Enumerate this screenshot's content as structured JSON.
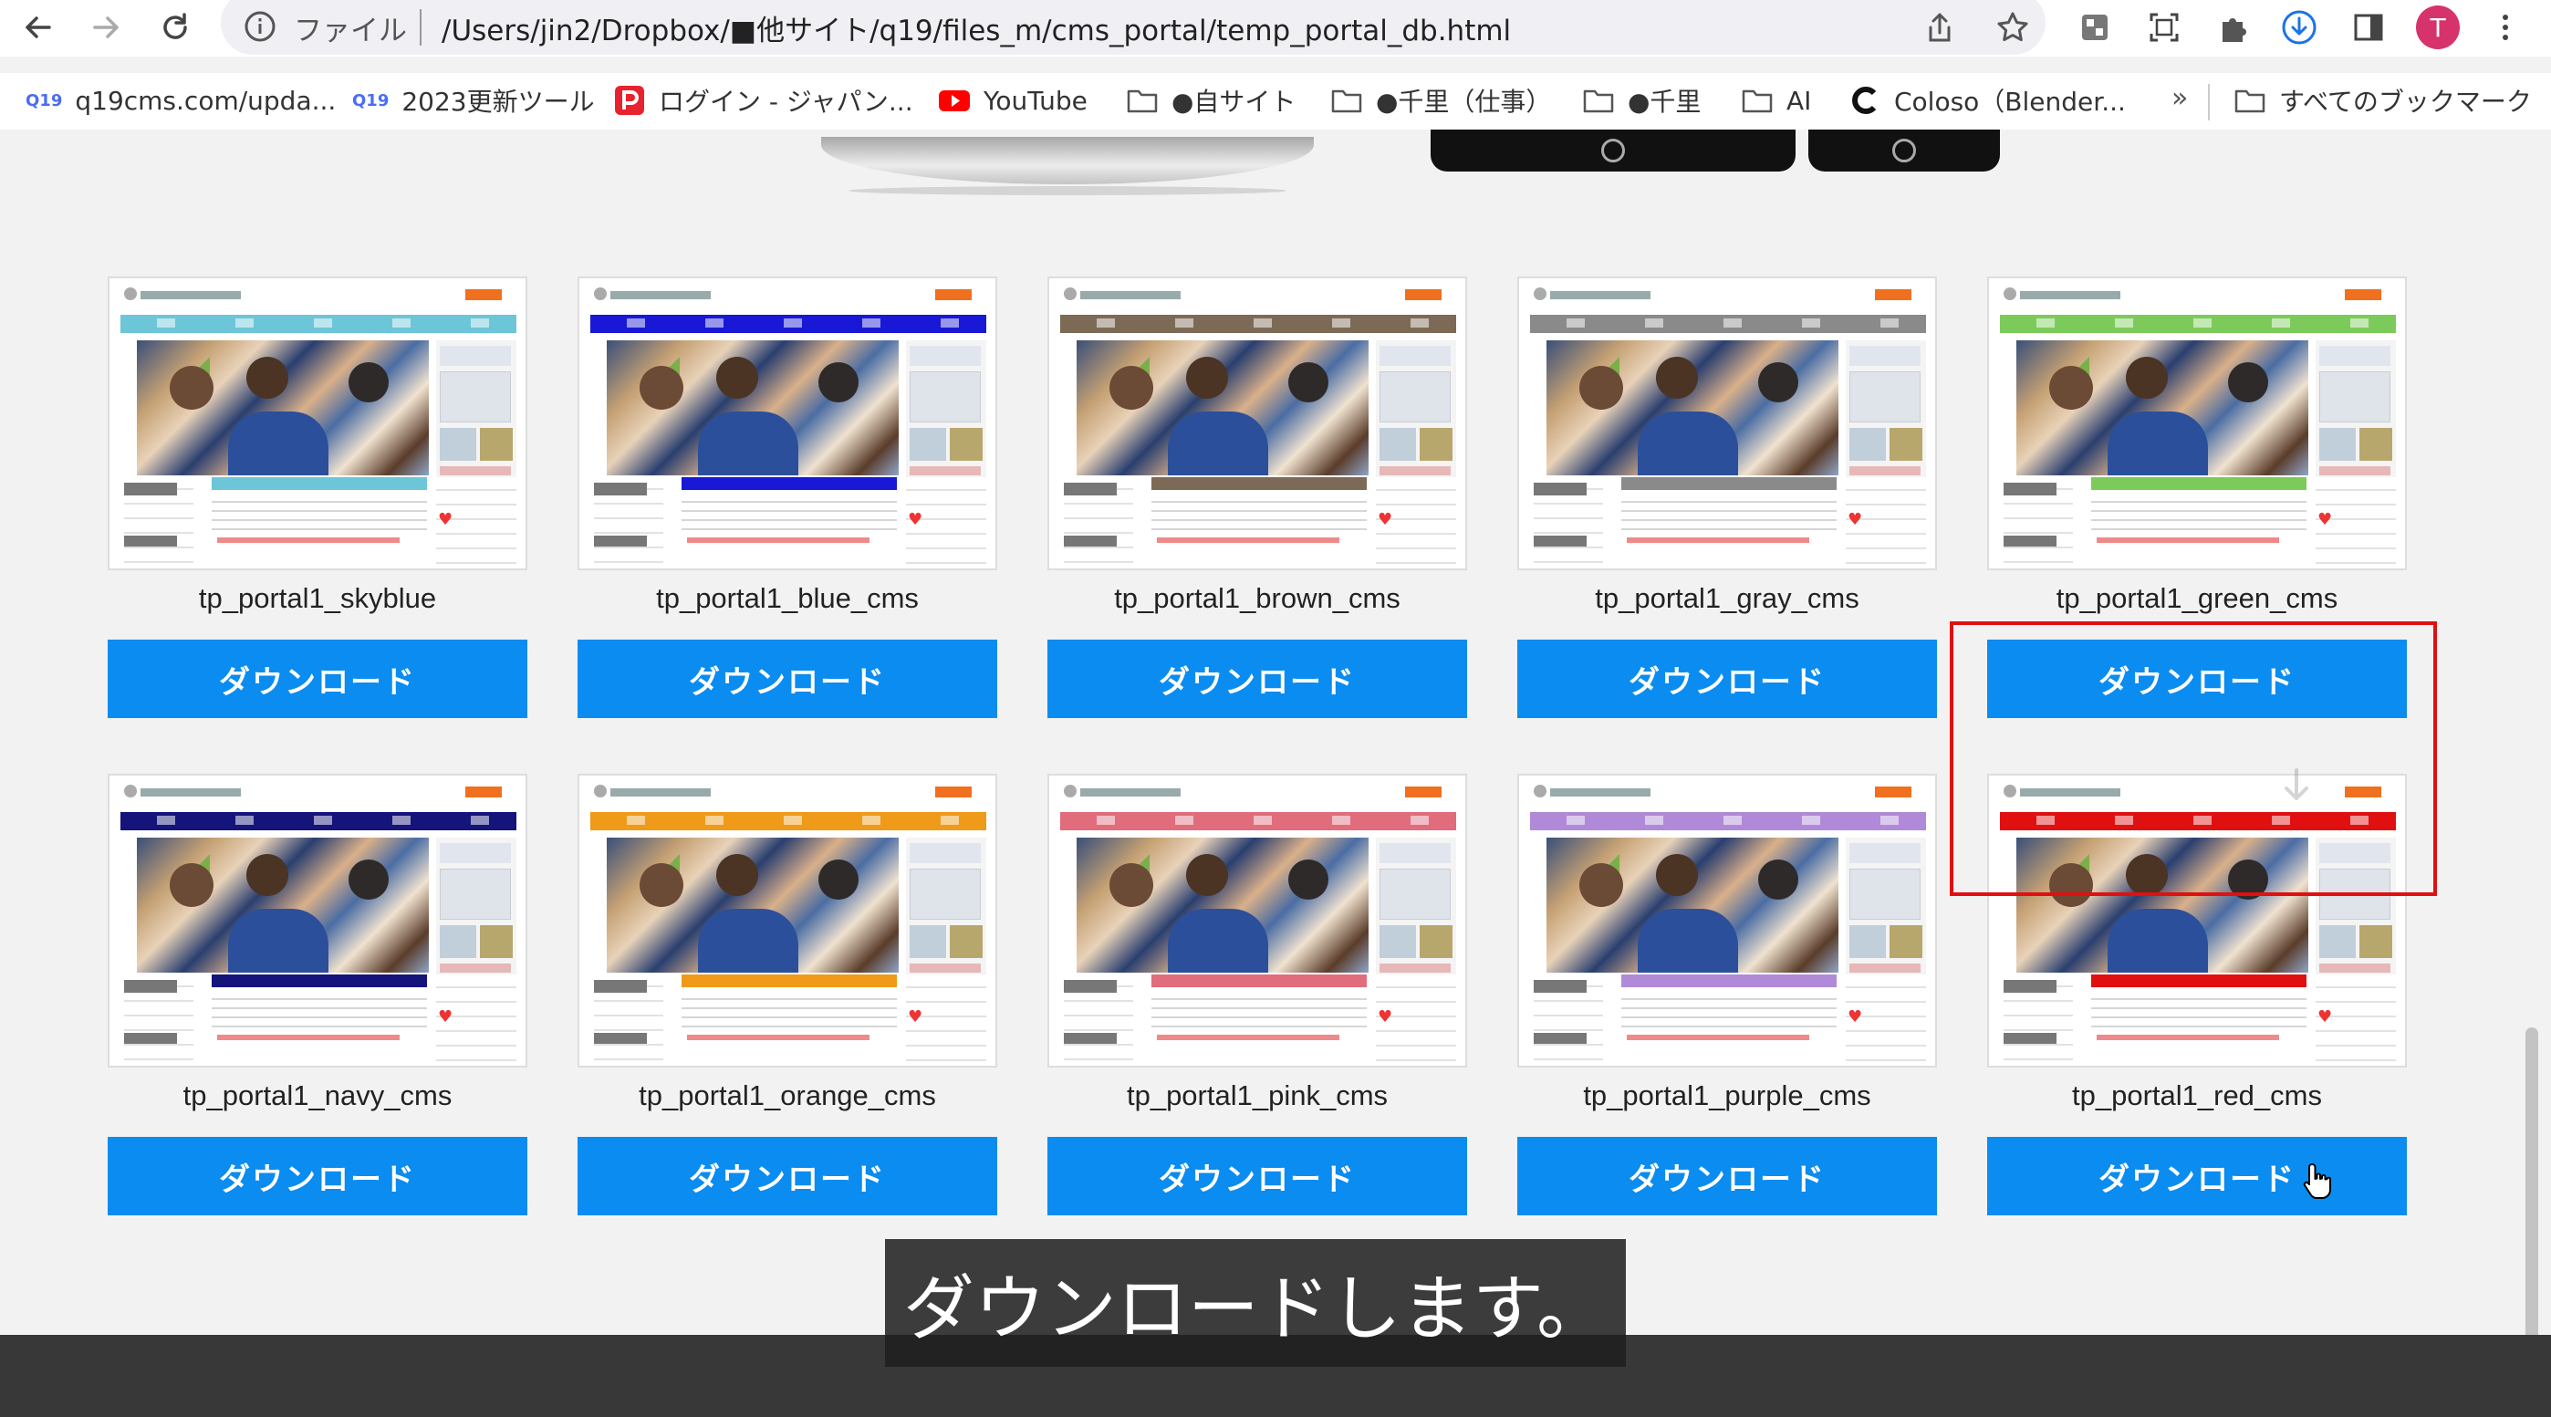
{
  "browser": {
    "url_scheme": "ファイル",
    "url_path": "/Users/jin2/Dropbox/■他サイト/q19/files_m/cms_portal/temp_portal_db.html",
    "profile_initial": "T"
  },
  "bookmarks": {
    "items": [
      {
        "label": "q19cms.com/upda...",
        "icon": "q19-favicon"
      },
      {
        "label": "2023更新ツール",
        "icon": "q19-favicon"
      },
      {
        "label": "ログイン - ジャパン...",
        "icon": "p-favicon"
      },
      {
        "label": "YouTube",
        "icon": "youtube-icon"
      },
      {
        "label": "●自サイト",
        "icon": "folder-icon"
      },
      {
        "label": "●千里（仕事）",
        "icon": "folder-icon"
      },
      {
        "label": "●千里",
        "icon": "folder-icon"
      },
      {
        "label": "AI",
        "icon": "folder-icon"
      },
      {
        "label": "Coloso（Blender...",
        "icon": "coloso-icon"
      }
    ],
    "overflow": "»",
    "all_bookmarks": "すべてのブックマーク",
    "q19_badge": "Q19"
  },
  "templates": {
    "download_label": "ダウンロード",
    "cards": [
      {
        "name": "tp_portal1_skyblue",
        "color": "#6cc6d8"
      },
      {
        "name": "tp_portal1_blue_cms",
        "color": "#1818d6"
      },
      {
        "name": "tp_portal1_brown_cms",
        "color": "#7d6a56"
      },
      {
        "name": "tp_portal1_gray_cms",
        "color": "#8a8a8a"
      },
      {
        "name": "tp_portal1_green_cms",
        "color": "#7ccb5a"
      },
      {
        "name": "tp_portal1_navy_cms",
        "color": "#14147a"
      },
      {
        "name": "tp_portal1_orange_cms",
        "color": "#ef9a18"
      },
      {
        "name": "tp_portal1_pink_cms",
        "color": "#e06c7c"
      },
      {
        "name": "tp_portal1_purple_cms",
        "color": "#b08ad8"
      },
      {
        "name": "tp_portal1_red_cms",
        "color": "#e01010"
      }
    ]
  },
  "caption": "ダウンロードします。",
  "colors": {
    "download_button": "#0a8cf0",
    "highlight_border": "#e01010",
    "avatar": "#d6336c"
  }
}
